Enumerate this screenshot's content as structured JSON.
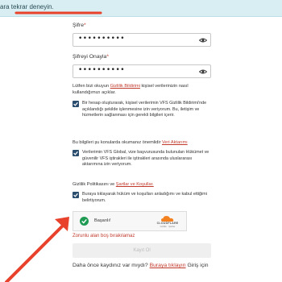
{
  "alert": {
    "text": "ara tekrar deneyin."
  },
  "form": {
    "password_label": "Şifre",
    "password_required": "*",
    "password_value": "••••••••••",
    "confirm_label": "Şifreyi Onayla",
    "confirm_required": "*",
    "confirm_value": "••••••••••",
    "privacy_intro_before": "Lütfen bizi okuyun ",
    "privacy_intro_link": "Gizlilik Bildirimi",
    "privacy_intro_after": " kişisel verilerinizin nasıl kullandığımızı açıklar.",
    "consent1": "Bir hesap oluşturarak, kişisel verilerimin VFS Gizlilik Bildirimi'nde açıklandığı şekilde işlenmesine izin veriyorum. Bu, iletişim ve hizmetlerin sağlanması için gerekli bilgileri içerir.",
    "transfer_intro_before": "Bu bilgileri şu konularda okumanız önemlidir ",
    "transfer_intro_link": "Veri Aktarımı",
    "consent2": "Verilerimin VFS Global, vize başvurusunda bulunulan Hükümet ve güvenilir VFS iştirakleri ile iştirakleri arasında uluslararası aktarımına izin veriyorum.",
    "terms_intro_before": "Gizlilik Politikasını ve ",
    "terms_intro_link": "Şartlar ve Koşullar.",
    "consent3": "Buraya tıklayarak hüküm ve koşulları anladığımı ve kabul ettiğimi belirtiyorum.",
    "captcha_status": "Başarılı!",
    "captcha_brand": "CLOUDFLARE",
    "captcha_sub": "Gizlilik · Şartlar",
    "error": "Zorunlu alan boş bırakılamaz",
    "submit_label": "Kayıt Ol",
    "bottom_before": "Daha önce kaydınız var mıydı? ",
    "bottom_link": "Buraya tıklayın",
    "bottom_after": " Giriş için"
  },
  "colors": {
    "accent_red": "#c0392b",
    "checkbox_navy": "#2a4d6e",
    "captcha_green": "#1f9a53",
    "cloudflare_orange": "#f48120",
    "annotation_red": "#e8412c"
  },
  "icons": [
    "eye-icon",
    "checkmark-icon",
    "cloudflare-logo",
    "annotation-arrow"
  ]
}
